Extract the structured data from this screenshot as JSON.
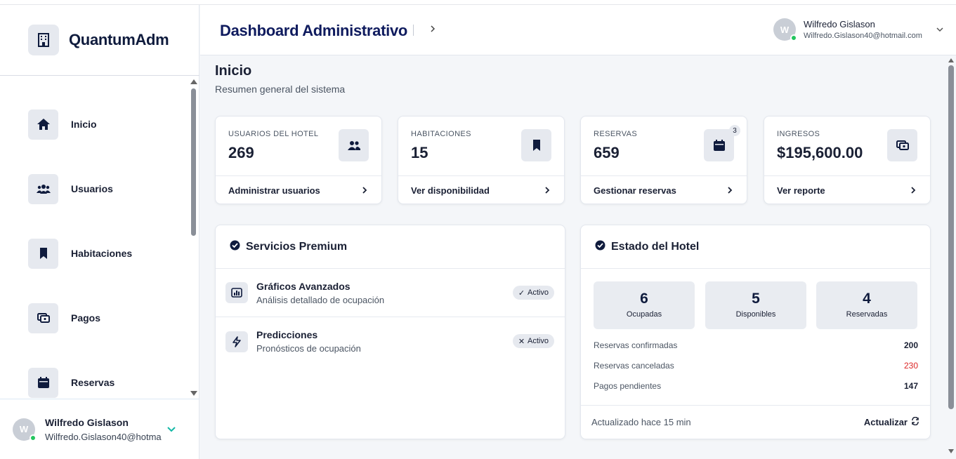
{
  "brand": {
    "name": "QuantumAdm",
    "icon": "building-icon"
  },
  "sidebar": {
    "items": [
      {
        "label": "Inicio",
        "icon": "home-icon"
      },
      {
        "label": "Usuarios",
        "icon": "users-icon"
      },
      {
        "label": "Habitaciones",
        "icon": "bookmark-icon"
      },
      {
        "label": "Pagos",
        "icon": "wallet-icon"
      },
      {
        "label": "Reservas",
        "icon": "calendar-icon"
      }
    ],
    "user": {
      "initial": "W",
      "name": "Wilfredo Gislason",
      "email": "Wilfredo.Gislason40@hotma"
    }
  },
  "header": {
    "title": "Dashboard Administrativo",
    "user": {
      "initial": "W",
      "name": "Wilfredo Gislason",
      "email": "Wilfredo.Gislason40@hotmail.com"
    }
  },
  "page": {
    "title": "Inicio",
    "subtitle": "Resumen general del sistema"
  },
  "stats": [
    {
      "label": "USUARIOS DEL HOTEL",
      "value": "269",
      "link": "Administrar usuarios",
      "icon": "users-icon"
    },
    {
      "label": "HABITACIONES",
      "value": "15",
      "link": "Ver disponibilidad",
      "icon": "bookmark-icon"
    },
    {
      "label": "RESERVAS",
      "value": "659",
      "link": "Gestionar reservas",
      "icon": "calendar-icon",
      "badge": "3"
    },
    {
      "label": "INGRESOS",
      "value": "$195,600.00",
      "link": "Ver reporte",
      "icon": "wallet-icon"
    }
  ],
  "premium": {
    "title": "Servicios Premium",
    "services": [
      {
        "title": "Gráficos Avanzados",
        "desc": "Análisis detallado de ocupación",
        "status": "Activo",
        "status_mark": "✓",
        "icon": "bar-chart-icon"
      },
      {
        "title": "Predicciones",
        "desc": "Pronósticos de ocupación",
        "status": "Activo",
        "status_mark": "✕",
        "icon": "lightning-icon"
      }
    ]
  },
  "hotel": {
    "title": "Estado del Hotel",
    "rooms": [
      {
        "value": "6",
        "label": "Ocupadas"
      },
      {
        "value": "5",
        "label": "Disponibles"
      },
      {
        "value": "4",
        "label": "Reservadas"
      }
    ],
    "rows": [
      {
        "label": "Reservas confirmadas",
        "value": "200",
        "color": "#1a2034"
      },
      {
        "label": "Reservas canceladas",
        "value": "230",
        "color": "#dc2626"
      },
      {
        "label": "Pagos pendientes",
        "value": "147",
        "color": "#1a2034"
      }
    ],
    "updated": "Actualizado hace 15 min",
    "refresh": "Actualizar"
  },
  "colors": {
    "accent": "#0f1b5e",
    "online": "#22c55e",
    "danger": "#dc2626",
    "teal": "#14b8a6"
  }
}
